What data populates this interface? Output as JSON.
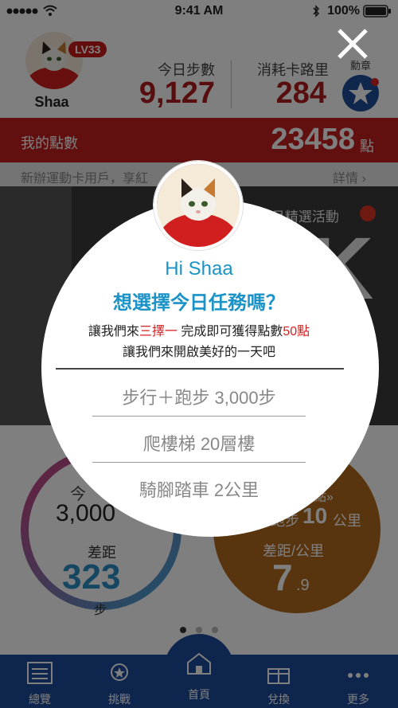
{
  "status_bar": {
    "time": "9:41 AM",
    "battery": "100%"
  },
  "header": {
    "level": "LV33",
    "username": "Shaa",
    "steps_label": "今日步數",
    "steps_value": "9,127",
    "calories_label": "消耗卡路里",
    "calories_value": "284",
    "badge_label": "勳章"
  },
  "points": {
    "label": "我的點數",
    "value": "23458",
    "unit": "點"
  },
  "promo": {
    "text": "新辦運動卡用戶，享紅",
    "details": "詳情 ›"
  },
  "banner": {
    "title": "10月精選活動",
    "big_letter_1": "K",
    "big_letter_2": "K"
  },
  "card_left": {
    "label_top": "今",
    "value": "3,000",
    "gap_label": "差距",
    "gap_value": "323",
    "unit": "步"
  },
  "card_right": {
    "label_top": "積點»",
    "run_label": "跑步",
    "run_value": "10",
    "run_unit": "公里",
    "gap_label": "差距/公里",
    "gap_value": "7",
    "gap_decimal": ".9"
  },
  "pager": {
    "count": 3,
    "active": 1
  },
  "nav": {
    "items": [
      {
        "label": "總覽",
        "icon": "list-icon"
      },
      {
        "label": "挑戰",
        "icon": "medal-icon"
      },
      {
        "label": "首頁",
        "icon": "house-icon"
      },
      {
        "label": "兌換",
        "icon": "gift-icon"
      },
      {
        "label": "更多",
        "icon": "more-icon"
      }
    ]
  },
  "popup": {
    "greeting": "Hi Shaa",
    "question": "想選擇今日任務嗎？",
    "line1_a": "讓我們來",
    "line1_b": "三擇一",
    "line1_c": " 完成即可獲得點數",
    "line1_d": "50點",
    "line2": "讓我們來開啟美好的一天吧",
    "options": [
      "步行＋跑步 3,000步",
      "爬樓梯 20層樓",
      "騎腳踏車 2公里"
    ]
  },
  "colors": {
    "brand_red": "#c41e1e",
    "nav_blue": "#1d4a9a",
    "accent_blue": "#1b93c7"
  }
}
